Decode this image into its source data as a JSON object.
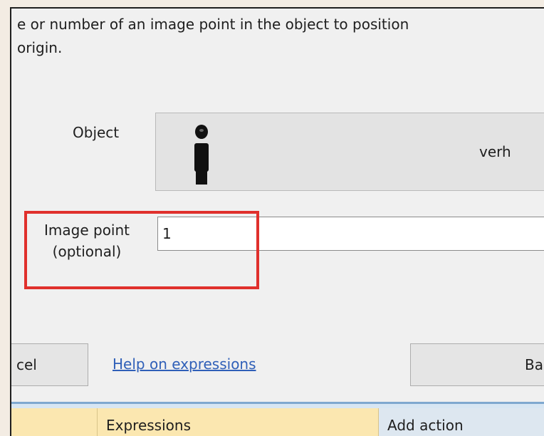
{
  "dialog": {
    "description_line1": "e or number of an image point in the object to position",
    "description_line2": "origin.",
    "object_label": "Object",
    "object_name": "verh",
    "image_point_label_line1": "Image point",
    "image_point_label_line2": "(optional)",
    "image_point_value": "1"
  },
  "buttons": {
    "cancel_label": "cel",
    "help_link": "Help on expressions",
    "back_label": "Back"
  },
  "bottom_tabs": {
    "exp_label": "Expressions",
    "add_label": "Add action"
  },
  "colors": {
    "highlight": "#e0302c",
    "link": "#2f5fb8"
  }
}
